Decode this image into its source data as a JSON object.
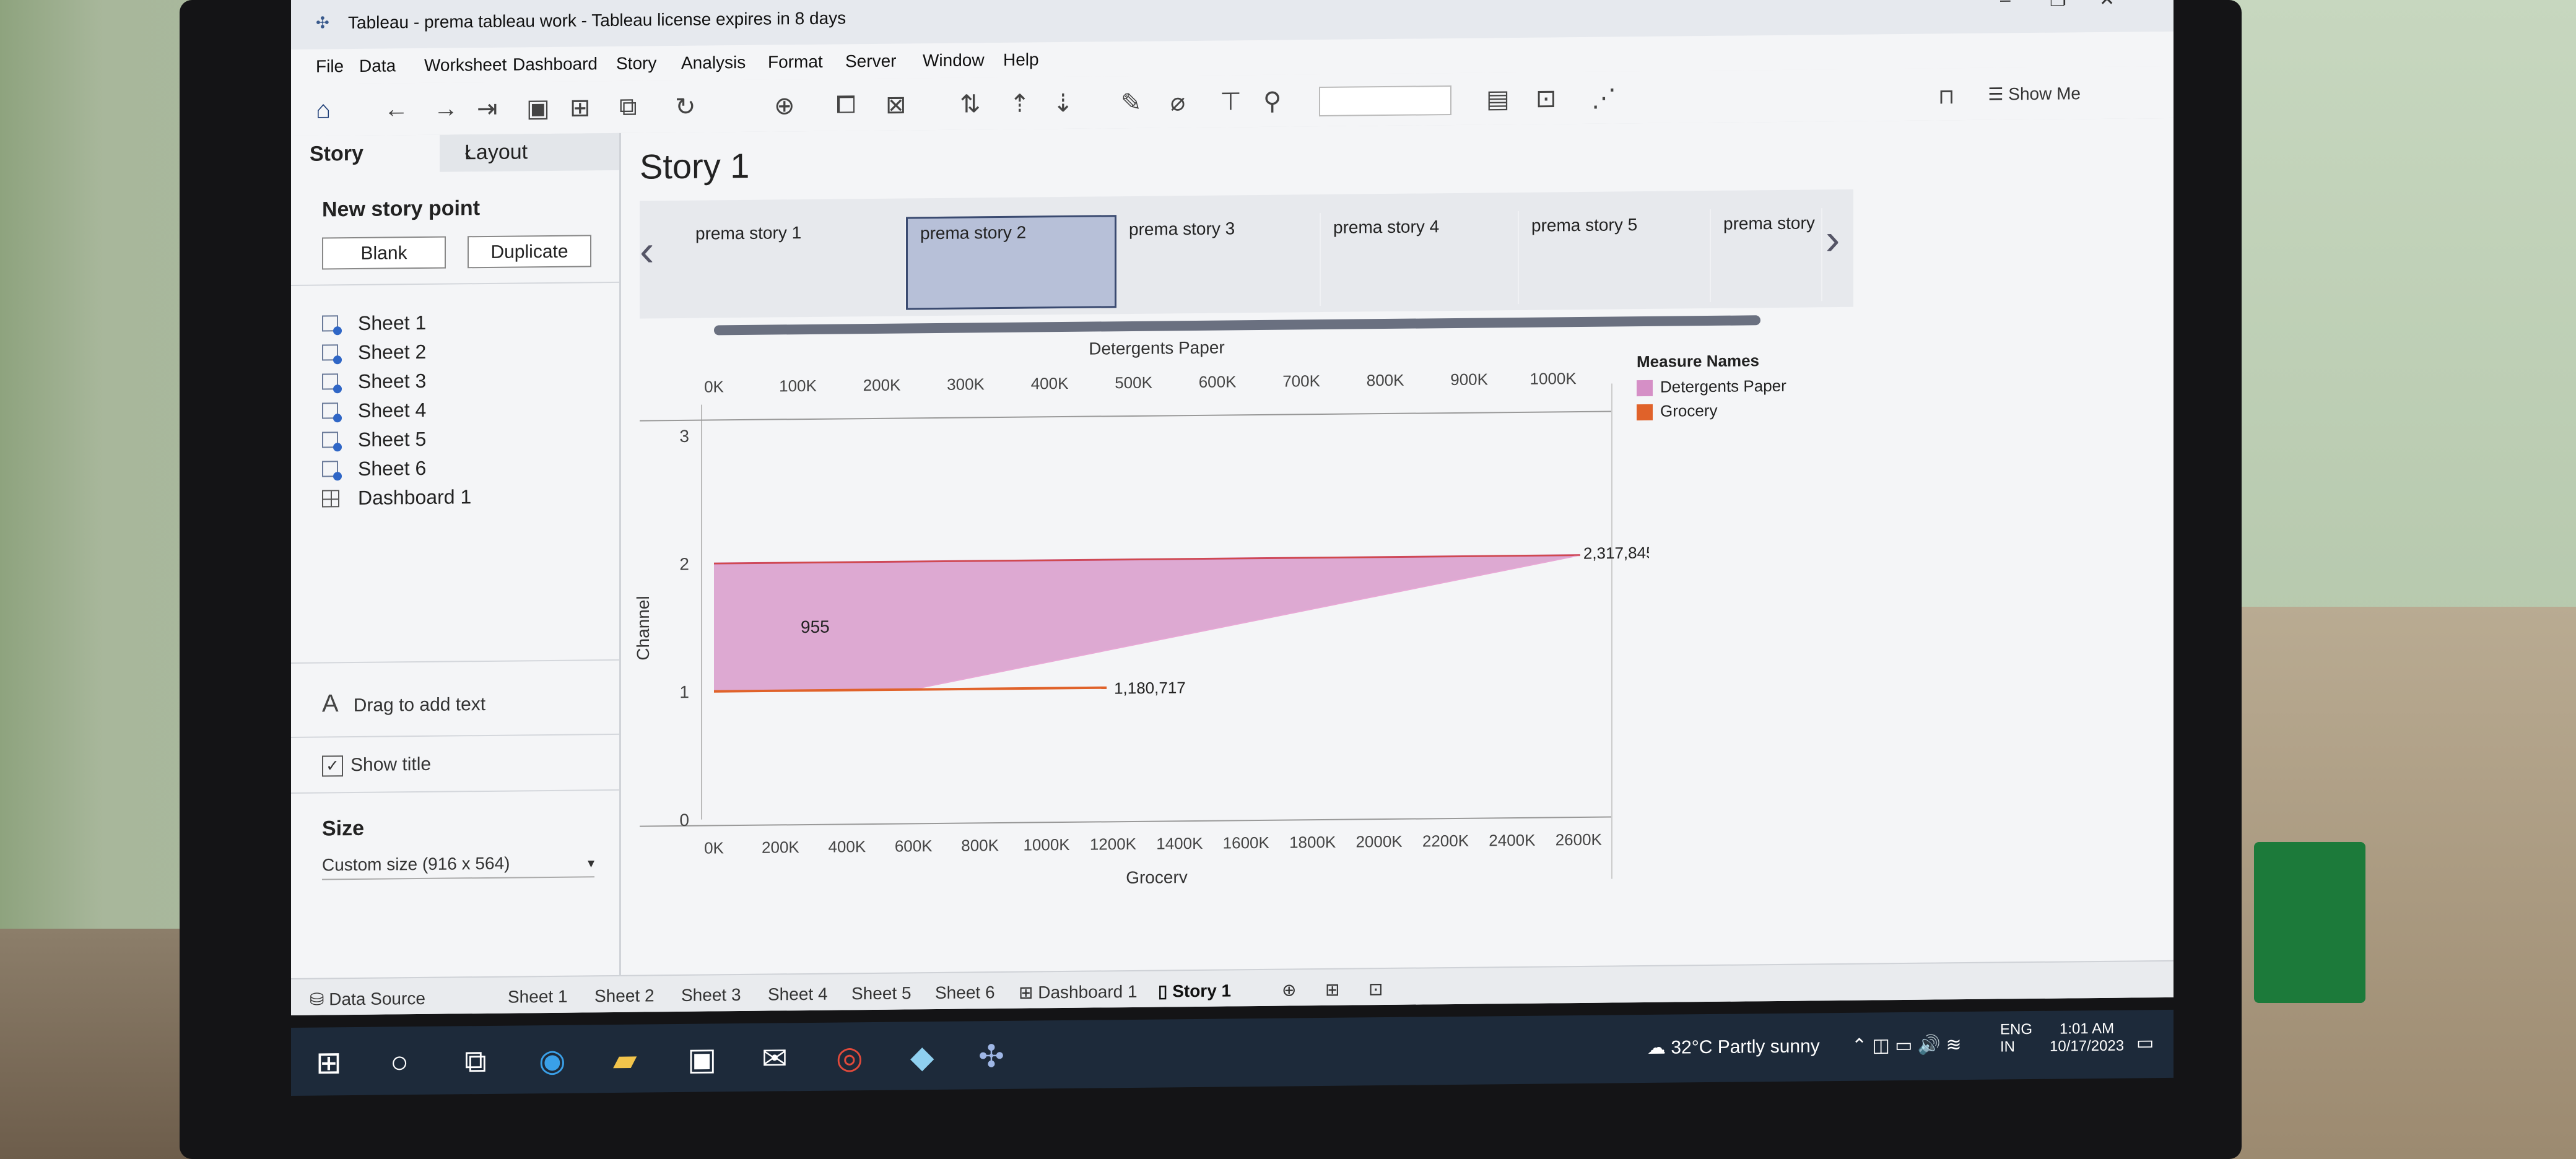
{
  "window": {
    "title": "Tableau - prema tableau work - Tableau license expires in 8 days"
  },
  "menu": [
    "File",
    "Data",
    "Worksheet",
    "Dashboard",
    "Story",
    "Analysis",
    "Format",
    "Server",
    "Window",
    "Help"
  ],
  "toolbar": {
    "show_me": "Show Me"
  },
  "left_pane": {
    "tab_story": "Story",
    "tab_layout": "Layout",
    "new_story_point": "New story point",
    "blank_button": "Blank",
    "duplicate_button": "Duplicate",
    "sheets": [
      "Sheet 1",
      "Sheet 2",
      "Sheet 3",
      "Sheet 4",
      "Sheet 5",
      "Sheet 6"
    ],
    "dashboard": "Dashboard 1",
    "drag_text": "Drag to add text",
    "show_title": "Show title",
    "size_header": "Size",
    "size_value": "Custom size (916 x 564)"
  },
  "story": {
    "title": "Story 1",
    "points": [
      "prema story 1",
      "prema story 2",
      "prema story 3",
      "prema story 4",
      "prema story 5",
      "prema story"
    ],
    "active_index": 1
  },
  "chart_data": {
    "type": "area",
    "top_axis_title": "Detergents Paper",
    "top_ticks": [
      "0K",
      "100K",
      "200K",
      "300K",
      "400K",
      "500K",
      "600K",
      "700K",
      "800K",
      "900K",
      "1000K"
    ],
    "bottom_axis_title": "Grocery",
    "bottom_ticks": [
      "0K",
      "200K",
      "400K",
      "600K",
      "800K",
      "1000K",
      "1200K",
      "1400K",
      "1600K",
      "1800K",
      "2000K",
      "2200K",
      "2400K",
      "2600K"
    ],
    "y_axis_title": "Channel",
    "y_ticks": [
      "0",
      "1",
      "2",
      "3"
    ],
    "ylim": [
      0,
      3
    ],
    "series": [
      {
        "name": "Detergents Paper",
        "color": "#d58fc6",
        "points": [
          {
            "channel": 1,
            "value": 235587
          },
          {
            "channel": 2,
            "value": 1032270
          }
        ]
      },
      {
        "name": "Grocery",
        "color": "#e0622a",
        "points": [
          {
            "channel": 1,
            "value": 1180717
          },
          {
            "channel": 2,
            "value": 2317845
          }
        ]
      }
    ],
    "labels": [
      "955",
      "2,317,845",
      "1,180,717"
    ],
    "legend_title": "Measure Names",
    "legend_placement": "right"
  },
  "bottom_tabs": {
    "data_source": "Data Source",
    "tabs": [
      "Sheet 1",
      "Sheet 2",
      "Sheet 3",
      "Sheet 4",
      "Sheet 5",
      "Sheet 6",
      "Dashboard 1",
      "Story 1"
    ],
    "active": "Story 1"
  },
  "taskbar": {
    "weather": "32°C  Partly sunny",
    "lang": "ENG",
    "region": "IN",
    "time": "1:01 AM",
    "date": "10/17/2023"
  }
}
